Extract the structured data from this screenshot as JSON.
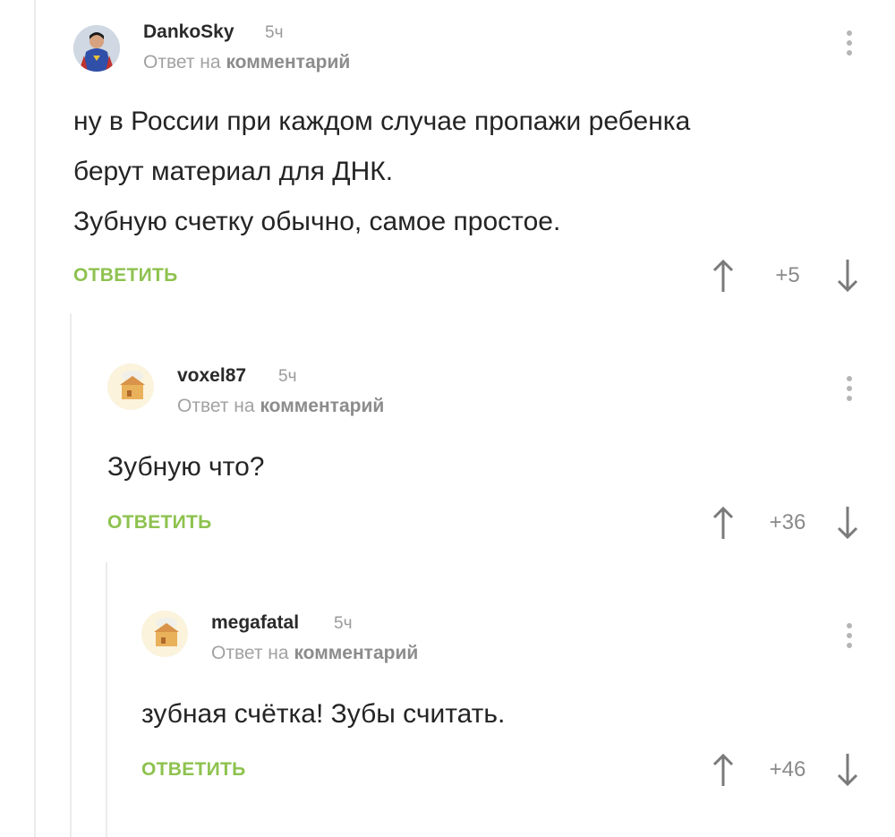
{
  "comments": [
    {
      "author": "DankoSky",
      "time": "5ч",
      "reply_prefix": "Ответ на",
      "reply_link": "комментарий",
      "lines": [
        "ну в России при каждом случае пропажи ребенка",
        "берут материал для ДНК.",
        "Зубную счетку обычно, самое простое."
      ],
      "reply_label": "ОТВЕТИТЬ",
      "rating": "+5"
    },
    {
      "author": "voxel87",
      "time": "5ч",
      "reply_prefix": "Ответ на",
      "reply_link": "комментарий",
      "lines": [
        "Зубную что?"
      ],
      "reply_label": "ОТВЕТИТЬ",
      "rating": "+36"
    },
    {
      "author": "megafatal",
      "time": "5ч",
      "reply_prefix": "Ответ на",
      "reply_link": "комментарий",
      "lines": [
        "зубная счётка! Зубы считать."
      ],
      "reply_label": "ОТВЕТИТЬ",
      "rating": "+46"
    }
  ],
  "colors": {
    "accent": "#8ec24f",
    "text": "#242424",
    "muted": "#9a9a9a"
  },
  "icons": [
    "more-vertical-icon",
    "arrow-up-icon",
    "arrow-down-icon"
  ]
}
